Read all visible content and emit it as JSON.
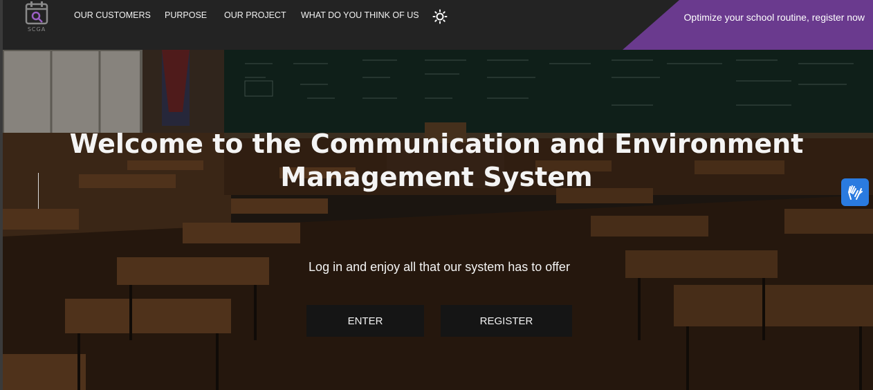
{
  "header": {
    "logo_text": "SCGA",
    "nav": [
      {
        "label": "OUR CUSTOMERS"
      },
      {
        "label": "PURPOSE"
      },
      {
        "label": "OUR PROJECT"
      },
      {
        "label": "WHAT DO YOU THINK OF US"
      }
    ],
    "theme_toggle_icon": "sun-icon",
    "promo_text": "Optimize your school routine, register now",
    "promo_color": "#6a3a8e"
  },
  "hero": {
    "title": "Welcome to the Communication and Environment Management System",
    "subtitle": "Log in and enjoy all that our system has to offer",
    "enter_label": "ENTER",
    "register_label": "REGISTER",
    "accessibility_icon": "sign-language-hands-icon",
    "accessibility_color": "#2a7be0"
  }
}
